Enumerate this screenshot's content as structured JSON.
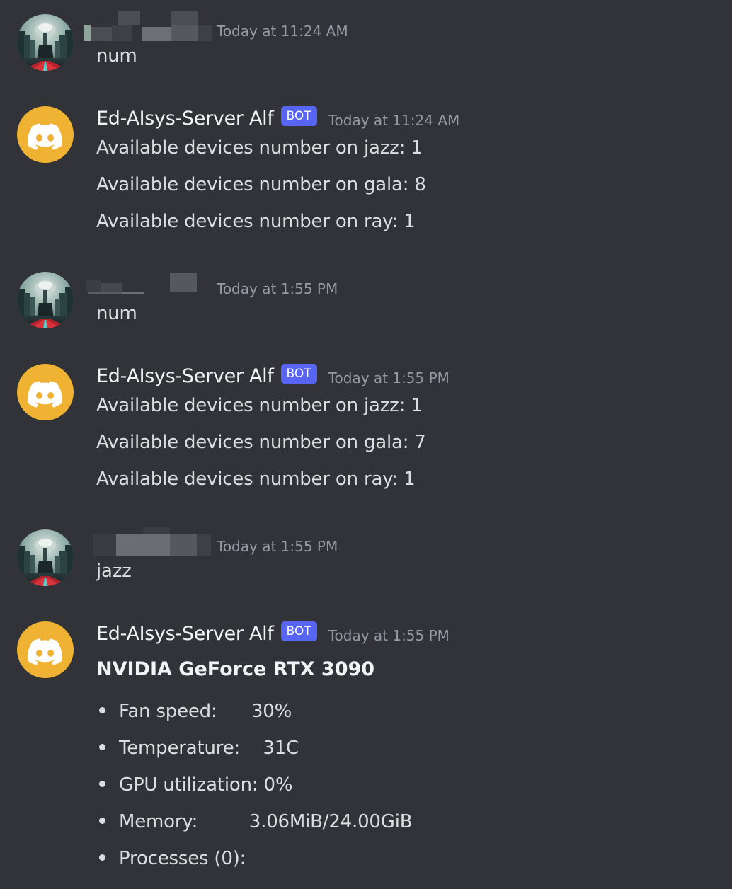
{
  "messages": [
    {
      "type": "user",
      "timestamp": "Today at 11:24 AM",
      "text": "num"
    },
    {
      "type": "bot",
      "username": "Ed-AIsys-Server Alf",
      "bot_tag": "BOT",
      "timestamp": "Today at 11:24 AM",
      "lines": [
        "Available devices number on jazz: 1",
        "Available devices number on gala: 8",
        "Available devices number on ray: 1"
      ]
    },
    {
      "type": "user",
      "timestamp": "Today at 1:55 PM",
      "text": "num"
    },
    {
      "type": "bot",
      "username": "Ed-AIsys-Server Alf",
      "bot_tag": "BOT",
      "timestamp": "Today at 1:55 PM",
      "lines": [
        "Available devices number on jazz: 1",
        "Available devices number on gala: 7",
        "Available devices number on ray: 1"
      ]
    },
    {
      "type": "user",
      "timestamp": "Today at 1:55 PM",
      "text": "jazz"
    },
    {
      "type": "bot",
      "username": "Ed-AIsys-Server Alf",
      "bot_tag": "BOT",
      "timestamp": "Today at 1:55 PM",
      "gpu_title": "NVIDIA GeForce RTX 3090",
      "bullets": [
        "Fan speed:      30%",
        "Temperature:    31C",
        "GPU utilization: 0%",
        "Memory:         3.06MiB/24.00GiB",
        "Processes (0):"
      ]
    }
  ],
  "icons": {
    "user_avatar": "forest-landscape-avatar",
    "bot_avatar": "discord-logo-icon"
  },
  "colors": {
    "background": "#313338",
    "bot_avatar_bg": "#f0b232",
    "bot_tag_bg": "#5865f2",
    "timestamp": "#949ba4",
    "text": "#dbdee1"
  }
}
